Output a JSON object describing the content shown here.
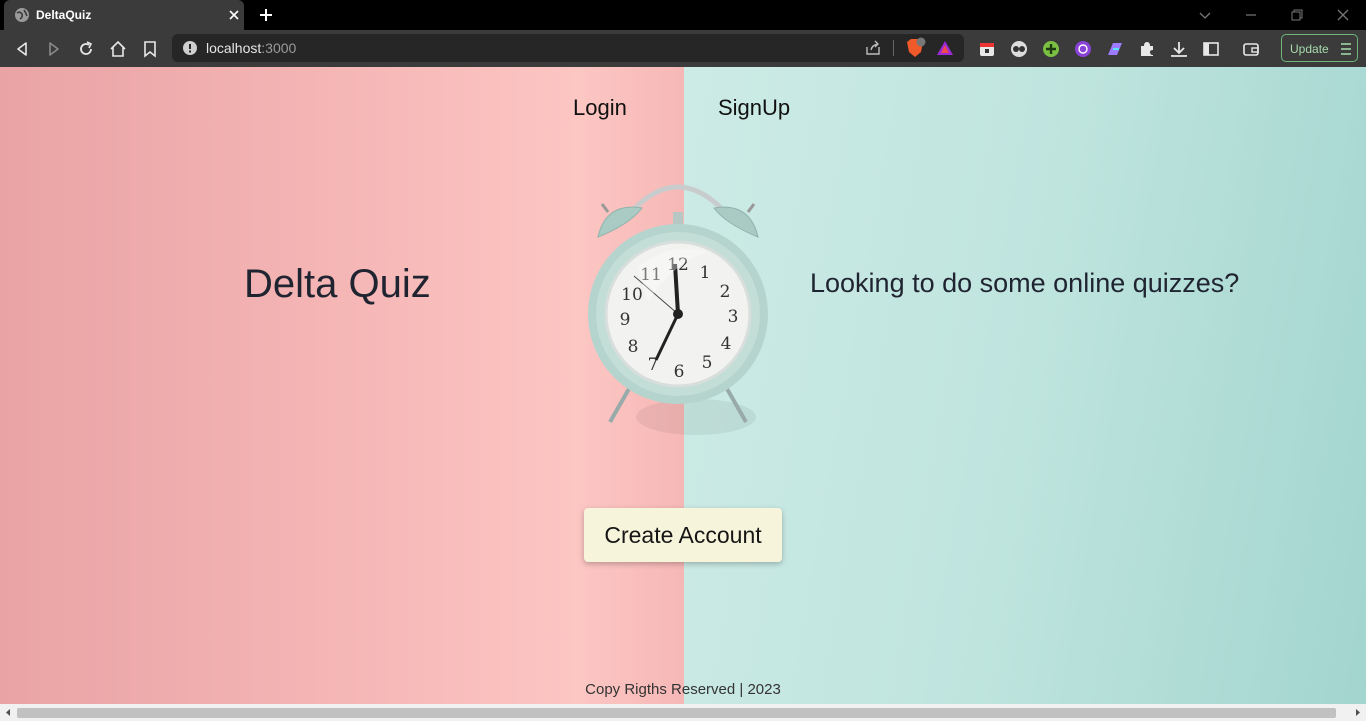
{
  "browser": {
    "tab_title": "DeltaQuiz",
    "url_host": "localhost",
    "url_path": ":3000",
    "update_label": "Update",
    "icons": [
      "globe-icon",
      "close-icon",
      "plus-icon",
      "back-icon",
      "forward-icon",
      "reload-icon",
      "home-icon",
      "bookmark-icon",
      "info-icon",
      "share-icon",
      "brave-shield-icon",
      "brave-rewards-icon",
      "extension-icons",
      "puzzle-icon",
      "download-icon",
      "sidebar-icon",
      "wallet-icon",
      "menu-icon"
    ]
  },
  "nav": {
    "login": "Login",
    "signup": "SignUp"
  },
  "hero": {
    "title": "Delta Quiz",
    "tagline": "Looking to do some online quizzes?",
    "cta": "Create Account"
  },
  "clock_numerals": [
    "12",
    "1",
    "2",
    "3",
    "4",
    "5",
    "6",
    "7",
    "8",
    "9",
    "10",
    "11"
  ],
  "footer": {
    "text": "Copy Rigths Reserved | 2023"
  },
  "colors": {
    "left_bg": "#f4b4b4",
    "right_bg": "#bfe4de",
    "button_bg": "#f7f4dc",
    "update_border": "#6fb57a"
  }
}
